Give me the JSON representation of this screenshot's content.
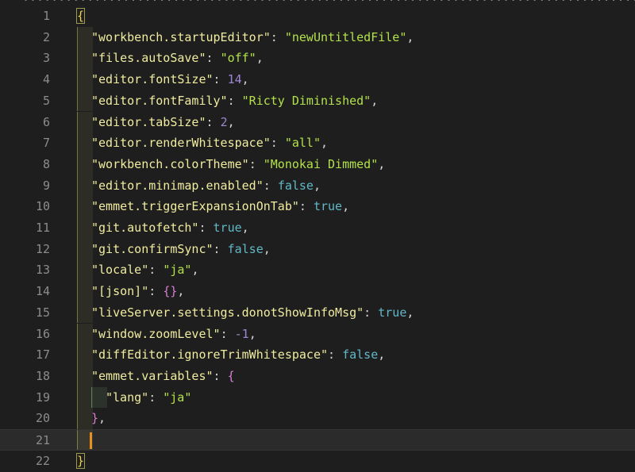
{
  "editor": {
    "top_sliver": "................................................................................................",
    "lines": [
      {
        "num": "1",
        "tokens": [
          {
            "t": "{",
            "c": "brace-y"
          }
        ]
      },
      {
        "num": "2",
        "indent": 1,
        "tokens": [
          {
            "t": "\"workbench.startupEditor\"",
            "c": "key"
          },
          {
            "t": ": ",
            "c": "punc"
          },
          {
            "t": "\"newUntitledFile\"",
            "c": "str"
          },
          {
            "t": ",",
            "c": "punc"
          }
        ]
      },
      {
        "num": "3",
        "indent": 1,
        "tokens": [
          {
            "t": "\"files.autoSave\"",
            "c": "key"
          },
          {
            "t": ": ",
            "c": "punc"
          },
          {
            "t": "\"off\"",
            "c": "str"
          },
          {
            "t": ",",
            "c": "punc"
          }
        ]
      },
      {
        "num": "4",
        "indent": 1,
        "tokens": [
          {
            "t": "\"editor.fontSize\"",
            "c": "key"
          },
          {
            "t": ": ",
            "c": "punc"
          },
          {
            "t": "14",
            "c": "num"
          },
          {
            "t": ",",
            "c": "punc"
          }
        ]
      },
      {
        "num": "5",
        "indent": 1,
        "tokens": [
          {
            "t": "\"editor.fontFamily\"",
            "c": "key"
          },
          {
            "t": ": ",
            "c": "punc"
          },
          {
            "t": "\"Ricty Diminished\"",
            "c": "str"
          },
          {
            "t": ",",
            "c": "punc"
          }
        ]
      },
      {
        "num": "6",
        "indent": 1,
        "tokens": [
          {
            "t": "\"editor.tabSize\"",
            "c": "key"
          },
          {
            "t": ": ",
            "c": "punc"
          },
          {
            "t": "2",
            "c": "num"
          },
          {
            "t": ",",
            "c": "punc"
          }
        ]
      },
      {
        "num": "7",
        "indent": 1,
        "tokens": [
          {
            "t": "\"editor.renderWhitespace\"",
            "c": "key"
          },
          {
            "t": ": ",
            "c": "punc"
          },
          {
            "t": "\"all\"",
            "c": "str"
          },
          {
            "t": ",",
            "c": "punc"
          }
        ]
      },
      {
        "num": "8",
        "indent": 1,
        "tokens": [
          {
            "t": "\"workbench.colorTheme\"",
            "c": "key"
          },
          {
            "t": ": ",
            "c": "punc"
          },
          {
            "t": "\"Monokai Dimmed\"",
            "c": "str"
          },
          {
            "t": ",",
            "c": "punc"
          }
        ]
      },
      {
        "num": "9",
        "indent": 1,
        "tokens": [
          {
            "t": "\"editor.minimap.enabled\"",
            "c": "key"
          },
          {
            "t": ": ",
            "c": "punc"
          },
          {
            "t": "false",
            "c": "bool"
          },
          {
            "t": ",",
            "c": "punc"
          }
        ]
      },
      {
        "num": "10",
        "indent": 1,
        "tokens": [
          {
            "t": "\"emmet.triggerExpansionOnTab\"",
            "c": "key"
          },
          {
            "t": ": ",
            "c": "punc"
          },
          {
            "t": "true",
            "c": "bool"
          },
          {
            "t": ",",
            "c": "punc"
          }
        ]
      },
      {
        "num": "11",
        "indent": 1,
        "tokens": [
          {
            "t": "\"git.autofetch\"",
            "c": "key"
          },
          {
            "t": ": ",
            "c": "punc"
          },
          {
            "t": "true",
            "c": "bool"
          },
          {
            "t": ",",
            "c": "punc"
          }
        ]
      },
      {
        "num": "12",
        "indent": 1,
        "tokens": [
          {
            "t": "\"git.confirmSync\"",
            "c": "key"
          },
          {
            "t": ": ",
            "c": "punc"
          },
          {
            "t": "false",
            "c": "bool"
          },
          {
            "t": ",",
            "c": "punc"
          }
        ]
      },
      {
        "num": "13",
        "indent": 1,
        "tokens": [
          {
            "t": "\"locale\"",
            "c": "key"
          },
          {
            "t": ": ",
            "c": "punc"
          },
          {
            "t": "\"ja\"",
            "c": "str"
          },
          {
            "t": ",",
            "c": "punc"
          }
        ]
      },
      {
        "num": "14",
        "indent": 1,
        "tokens": [
          {
            "t": "\"[json]\"",
            "c": "key"
          },
          {
            "t": ": ",
            "c": "punc"
          },
          {
            "t": "{}",
            "c": "brace-p"
          },
          {
            "t": ",",
            "c": "punc"
          }
        ]
      },
      {
        "num": "15",
        "indent": 1,
        "tokens": [
          {
            "t": "\"liveServer.settings.donotShowInfoMsg\"",
            "c": "key"
          },
          {
            "t": ": ",
            "c": "punc"
          },
          {
            "t": "true",
            "c": "bool"
          },
          {
            "t": ",",
            "c": "punc"
          }
        ]
      },
      {
        "num": "16",
        "indent": 1,
        "tokens": [
          {
            "t": "\"window.zoomLevel\"",
            "c": "key"
          },
          {
            "t": ": ",
            "c": "punc"
          },
          {
            "t": "-1",
            "c": "num"
          },
          {
            "t": ",",
            "c": "punc"
          }
        ]
      },
      {
        "num": "17",
        "indent": 1,
        "tokens": [
          {
            "t": "\"diffEditor.ignoreTrimWhitespace\"",
            "c": "key"
          },
          {
            "t": ": ",
            "c": "punc"
          },
          {
            "t": "false",
            "c": "bool"
          },
          {
            "t": ",",
            "c": "punc"
          }
        ]
      },
      {
        "num": "18",
        "indent": 1,
        "tokens": [
          {
            "t": "\"emmet.variables\"",
            "c": "key"
          },
          {
            "t": ": ",
            "c": "punc"
          },
          {
            "t": "{",
            "c": "brace-p"
          }
        ]
      },
      {
        "num": "19",
        "indent": 2,
        "tokens": [
          {
            "t": "\"lang\"",
            "c": "key"
          },
          {
            "t": ": ",
            "c": "punc"
          },
          {
            "t": "\"ja\"",
            "c": "str"
          }
        ]
      },
      {
        "num": "20",
        "indent": 1,
        "tokens": [
          {
            "t": "}",
            "c": "brace-p"
          },
          {
            "t": ",",
            "c": "punc"
          }
        ]
      },
      {
        "num": "21",
        "indent": 1,
        "current": true,
        "tokens": []
      },
      {
        "num": "22",
        "tokens": [
          {
            "t": "}",
            "c": "brace-y"
          }
        ]
      }
    ]
  },
  "colors": {
    "background": "#1e1e1e",
    "key": "#f0eca0",
    "string": "#b3e14a",
    "number": "#9e86d2",
    "boolean": "#62b8c7",
    "cursor": "#e8901e",
    "line_number": "#8c8c8c"
  }
}
